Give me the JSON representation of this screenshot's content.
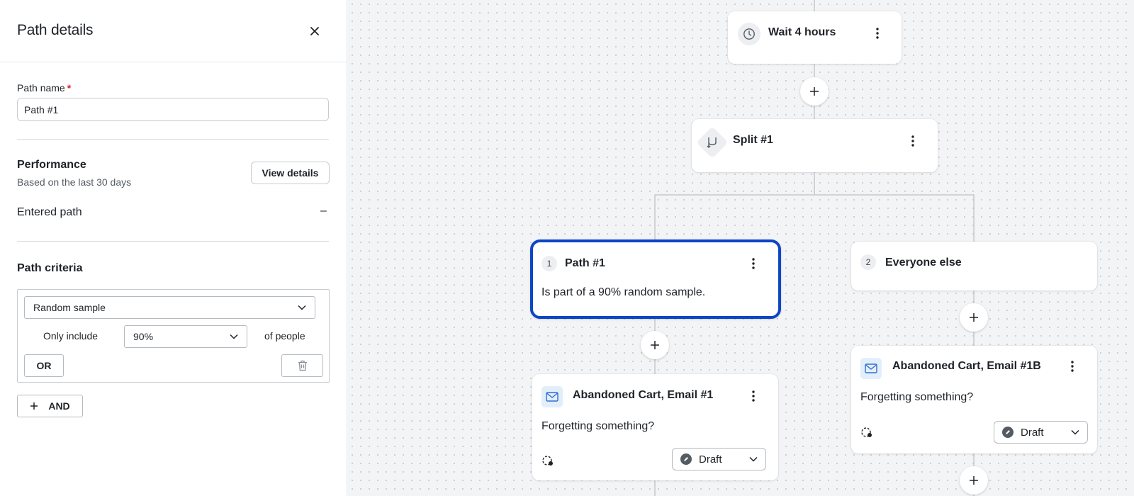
{
  "panel": {
    "title": "Path details",
    "path_name_label": "Path name",
    "required_mark": "*",
    "path_name_value": "Path #1",
    "performance_title": "Performance",
    "performance_subtitle": "Based on the last 30 days",
    "view_details_label": "View details",
    "entered_path_label": "Entered path",
    "entered_path_value": "–",
    "criteria_title": "Path criteria",
    "criteria_type": "Random sample",
    "only_include_label": "Only include",
    "percent_value": "90%",
    "of_people_label": "of people",
    "or_label": "OR",
    "and_label": "AND"
  },
  "canvas": {
    "wait_node": {
      "title": "Wait 4 hours",
      "icon": "clock-icon"
    },
    "split_node": {
      "title": "Split #1",
      "icon": "split-icon"
    },
    "path1": {
      "number": "1",
      "title": "Path #1",
      "description": "Is part of a 90% random sample."
    },
    "path2": {
      "number": "2",
      "title": "Everyone else"
    },
    "email1": {
      "title": "Abandoned Cart, Email #1",
      "subject": "Forgetting something?",
      "status": "Draft"
    },
    "email1b": {
      "title": "Abandoned Cart, Email #1B",
      "subject": "Forgetting something?",
      "status": "Draft"
    }
  },
  "colors": {
    "selected_border": "#0c45c7",
    "required": "#d1242f",
    "email_icon_bg": "#e3eefb",
    "email_icon": "#2f6fd1"
  }
}
